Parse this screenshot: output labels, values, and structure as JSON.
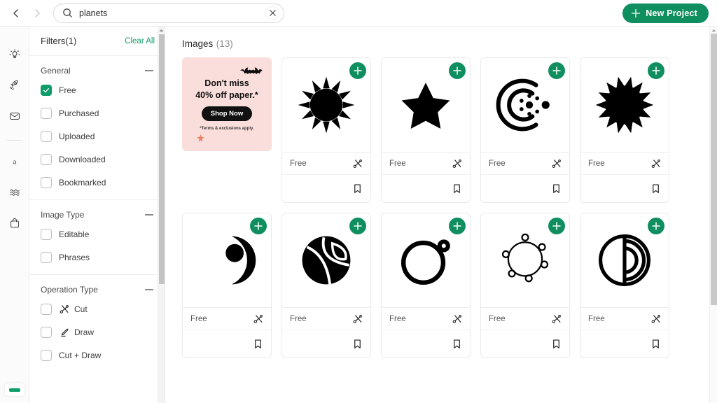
{
  "topbar": {
    "back_icon": "chevron-left-icon",
    "forward_icon": "chevron-right-icon",
    "search": {
      "icon": "search-icon",
      "value": "planets",
      "placeholder": "Search",
      "clear_icon": "close-icon"
    },
    "new_project_label": "New Project",
    "new_project_icon": "plus-icon",
    "accent_green": "#0f8f5f"
  },
  "rail": {
    "items": [
      {
        "icon": "lightbulb-icon",
        "name": "ideas"
      },
      {
        "icon": "rocket-icon",
        "name": "explore"
      },
      {
        "icon": "inbox-icon",
        "name": "inbox"
      },
      {
        "icon": "font-icon",
        "name": "fonts"
      },
      {
        "icon": "waves-icon",
        "name": "patterns"
      },
      {
        "icon": "bag-icon",
        "name": "shop"
      }
    ],
    "indicator_color": "#0f9e6a"
  },
  "filters": {
    "title": "Filters(1)",
    "clear_all": "Clear All",
    "collapse_icon": "minus-icon",
    "groups": [
      {
        "title": "General",
        "items": [
          {
            "label": "Free",
            "checked": true
          },
          {
            "label": "Purchased",
            "checked": false
          },
          {
            "label": "Uploaded",
            "checked": false
          },
          {
            "label": "Downloaded",
            "checked": false
          },
          {
            "label": "Bookmarked",
            "checked": false
          }
        ]
      },
      {
        "title": "Image Type",
        "items": [
          {
            "label": "Editable",
            "checked": false
          },
          {
            "label": "Phrases",
            "checked": false
          }
        ]
      },
      {
        "title": "Operation Type",
        "items": [
          {
            "label": "Cut",
            "checked": false,
            "icon": "scissors-icon"
          },
          {
            "label": "Draw",
            "checked": false,
            "icon": "pen-icon"
          },
          {
            "label": "Cut + Draw",
            "checked": false
          }
        ]
      }
    ]
  },
  "main": {
    "heading": "Images",
    "count": "(13)",
    "promo": {
      "line1": "Don't miss",
      "line2": "40% off paper.*",
      "button": "Shop Now",
      "terms": "*Terms & exclusions apply.",
      "bat_icon": "bat-icon",
      "star_icon": "star-icon",
      "bg_color": "#fadedb"
    },
    "cards": [
      {
        "art": "sun-icon",
        "price": "Free",
        "op_icon": "scissors-icon",
        "bookmark_icon": "bookmark-icon",
        "add_icon": "plus-icon"
      },
      {
        "art": "star-icon",
        "price": "Free",
        "op_icon": "scissors-icon",
        "bookmark_icon": "bookmark-icon",
        "add_icon": "plus-icon"
      },
      {
        "art": "orbit-icon",
        "price": "Free",
        "op_icon": "scissors-icon",
        "bookmark_icon": "bookmark-icon",
        "add_icon": "plus-icon"
      },
      {
        "art": "spiky-sun-icon",
        "price": "Free",
        "op_icon": "scissors-icon",
        "bookmark_icon": "bookmark-icon",
        "add_icon": "plus-icon"
      },
      {
        "art": "moon-phases-icon",
        "price": "Free",
        "op_icon": "scissors-icon",
        "bookmark_icon": "bookmark-icon",
        "add_icon": "plus-icon"
      },
      {
        "art": "segmented-planet-icon",
        "price": "Free",
        "op_icon": "scissors-icon",
        "bookmark_icon": "bookmark-icon",
        "add_icon": "plus-icon"
      },
      {
        "art": "ring-planet-icon",
        "price": "Free",
        "op_icon": "scissors-icon",
        "bookmark_icon": "bookmark-icon",
        "add_icon": "plus-icon"
      },
      {
        "art": "orbiting-dots-icon",
        "price": "Free",
        "op_icon": "scissors-icon",
        "bookmark_icon": "bookmark-icon",
        "add_icon": "plus-icon"
      },
      {
        "art": "arc-planet-icon",
        "price": "Free",
        "op_icon": "scissors-icon",
        "bookmark_icon": "bookmark-icon",
        "add_icon": "plus-icon"
      }
    ]
  }
}
